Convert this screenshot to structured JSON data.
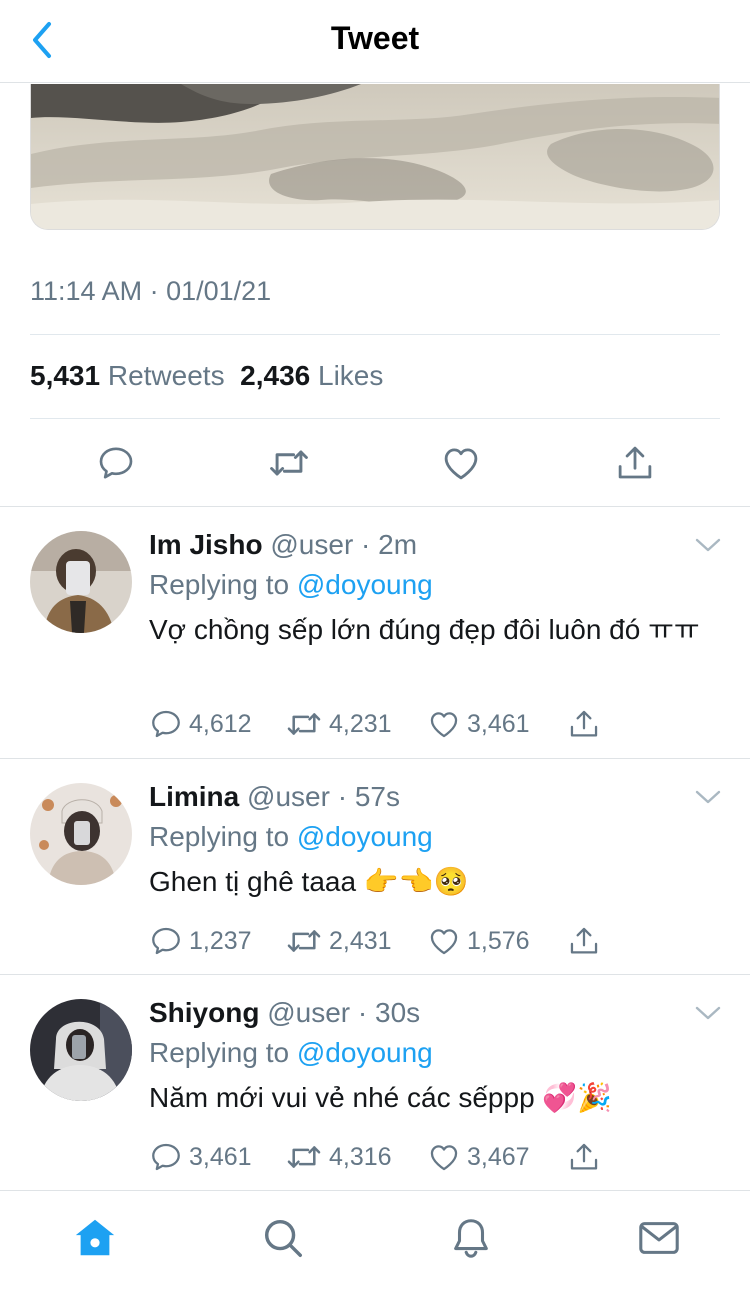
{
  "header": {
    "title": "Tweet"
  },
  "tweet": {
    "timestamp": "11:14 AM · 01/01/21",
    "retweets_count": "5,431",
    "retweets_label": "Retweets",
    "likes_count": "2,436",
    "likes_label": "Likes"
  },
  "replies": [
    {
      "name": "Im Jisho",
      "handle": "@user",
      "time": "2m",
      "replying_prefix": "Replying to",
      "mention": "@doyoung",
      "text": "Vợ chồng sếp lớn đúng đẹp đôi luôn đó ㅠㅠ",
      "reply_count": "4,612",
      "retweet_count": "4,231",
      "like_count": "3,461"
    },
    {
      "name": "Limina",
      "handle": "@user",
      "time": "57s",
      "replying_prefix": "Replying to",
      "mention": "@doyoung",
      "text": "Ghen tị ghê taaa 👉👈🥺",
      "reply_count": "1,237",
      "retweet_count": "2,431",
      "like_count": "1,576"
    },
    {
      "name": "Shiyong",
      "handle": "@user",
      "time": "30s",
      "replying_prefix": "Replying to",
      "mention": "@doyoung",
      "text": "Năm mới vui vẻ nhé các sếppp 💞🎉",
      "reply_count": "3,461",
      "retweet_count": "4,316",
      "like_count": "3,467"
    }
  ],
  "icons": {
    "back": "chevron-left-icon",
    "reply": "reply-icon",
    "retweet": "retweet-icon",
    "like": "heart-icon",
    "share": "share-icon",
    "home": "home-icon",
    "search": "search-icon",
    "notifications": "bell-icon",
    "messages": "mail-icon"
  },
  "colors": {
    "accent": "#1da1f2",
    "muted": "#657786",
    "text": "#14171a"
  }
}
